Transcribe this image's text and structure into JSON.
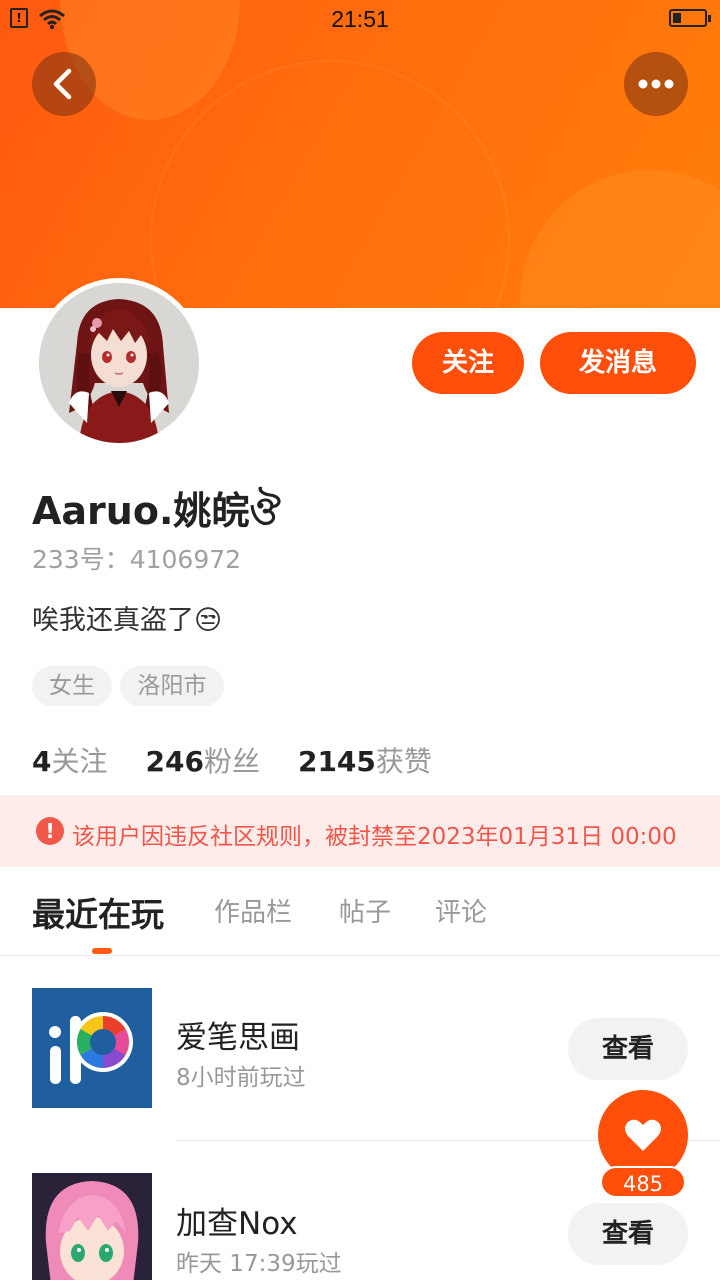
{
  "status_bar": {
    "time": "21:51",
    "sim_icon": "sim-alert-icon",
    "wifi_icon": "wifi-icon",
    "battery_icon": "battery-low-icon"
  },
  "header": {
    "back_icon": "chevron-left-icon",
    "more_icon": "more-horizontal-icon",
    "banner_color": "#ff6a0e"
  },
  "profile": {
    "username": "Aaruo.姚皖ঔ",
    "uid": "233号：4106972",
    "bio": "唉我还真盗了😒",
    "tags": [
      "女生",
      "洛阳市"
    ],
    "follow_label": "关注",
    "message_label": "发消息",
    "stats": [
      {
        "value": "4",
        "label": "关注"
      },
      {
        "value": "246",
        "label": "粉丝"
      },
      {
        "value": "2145",
        "label": "获赞"
      }
    ]
  },
  "ban_notice": {
    "icon": "alert-circle-icon",
    "text": "该用户因违反社区规则，被封禁至2023年01月31日 00:00"
  },
  "tabs": [
    {
      "label": "最近在玩",
      "active": true
    },
    {
      "label": "作品栏",
      "active": false
    },
    {
      "label": "帖子",
      "active": false
    },
    {
      "label": "评论",
      "active": false
    }
  ],
  "games": [
    {
      "name": "爱笔思画",
      "sub": "8小时前玩过",
      "button": "查看"
    },
    {
      "name": "加查Nox",
      "sub": "昨天 17:39玩过",
      "button": "查看"
    }
  ],
  "like": {
    "icon": "heart-icon",
    "count": "485"
  },
  "colors": {
    "accent": "#ff4f0a",
    "ban_text": "#f0564a",
    "ban_bg": "#fdecea"
  }
}
